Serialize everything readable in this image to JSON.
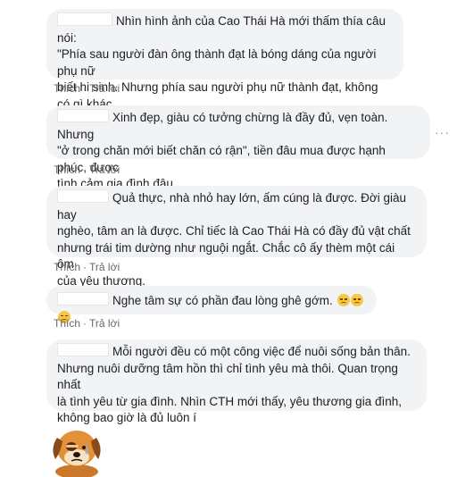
{
  "actions": {
    "like": "Thích",
    "reply": "Trả lời",
    "separator": "·"
  },
  "comments": [
    {
      "text": "Nhìn hình ảnh của Cao Thái Hà mới thấm thía câu nói:\n\"Phía sau người đàn ông thành đạt là bóng dáng của người phụ nữ\nbiết hi sinh. Nhưng phía sau người phụ nữ thành đạt, không có gì khác\nngoài cô đơn\"."
    },
    {
      "text": "Xinh đẹp, giàu có tưởng chừng là đầy đủ, vẹn toàn. Nhưng\n\"ở trong chăn mới biết chăn có rận\", tiền đâu mua được hạnh phúc, được\ntình cảm gia đình đâu.",
      "more_icon": "more-options-icon"
    },
    {
      "text": "Quả thực, nhà nhỏ hay lớn, ấm cúng là được. Đời giàu hay\nnghèo, tâm an là được. Chỉ tiếc là Cao Thái Hà có đầy đủ vật chất\nnhưng trái tim dường như nguội ngắt. Chắc cô ấy thèm một cái ôm\ncủa yêu thương."
    },
    {
      "text": "Nghe tâm sự có phần đau lòng ghê gớm.",
      "emojis": [
        "sad-face-icon",
        "sad-face-icon",
        "sad-face-icon"
      ]
    },
    {
      "text": "Mỗi người đều có một công việc để nuôi sống bản thân.\nNhưng nuôi dưỡng tâm hồn thì chỉ tình yêu mà thôi. Quan trọng nhất\nlà tình yêu từ gia đình. Nhìn CTH mới thấy, yêu thương gia đình,\nkhông bao giờ là đủ luôn í"
    }
  ],
  "sticker": "sad-dog-sticker-icon",
  "colors": {
    "bubble": "#f2f3f5",
    "action_text": "#65676b",
    "text": "#1c1e21"
  }
}
